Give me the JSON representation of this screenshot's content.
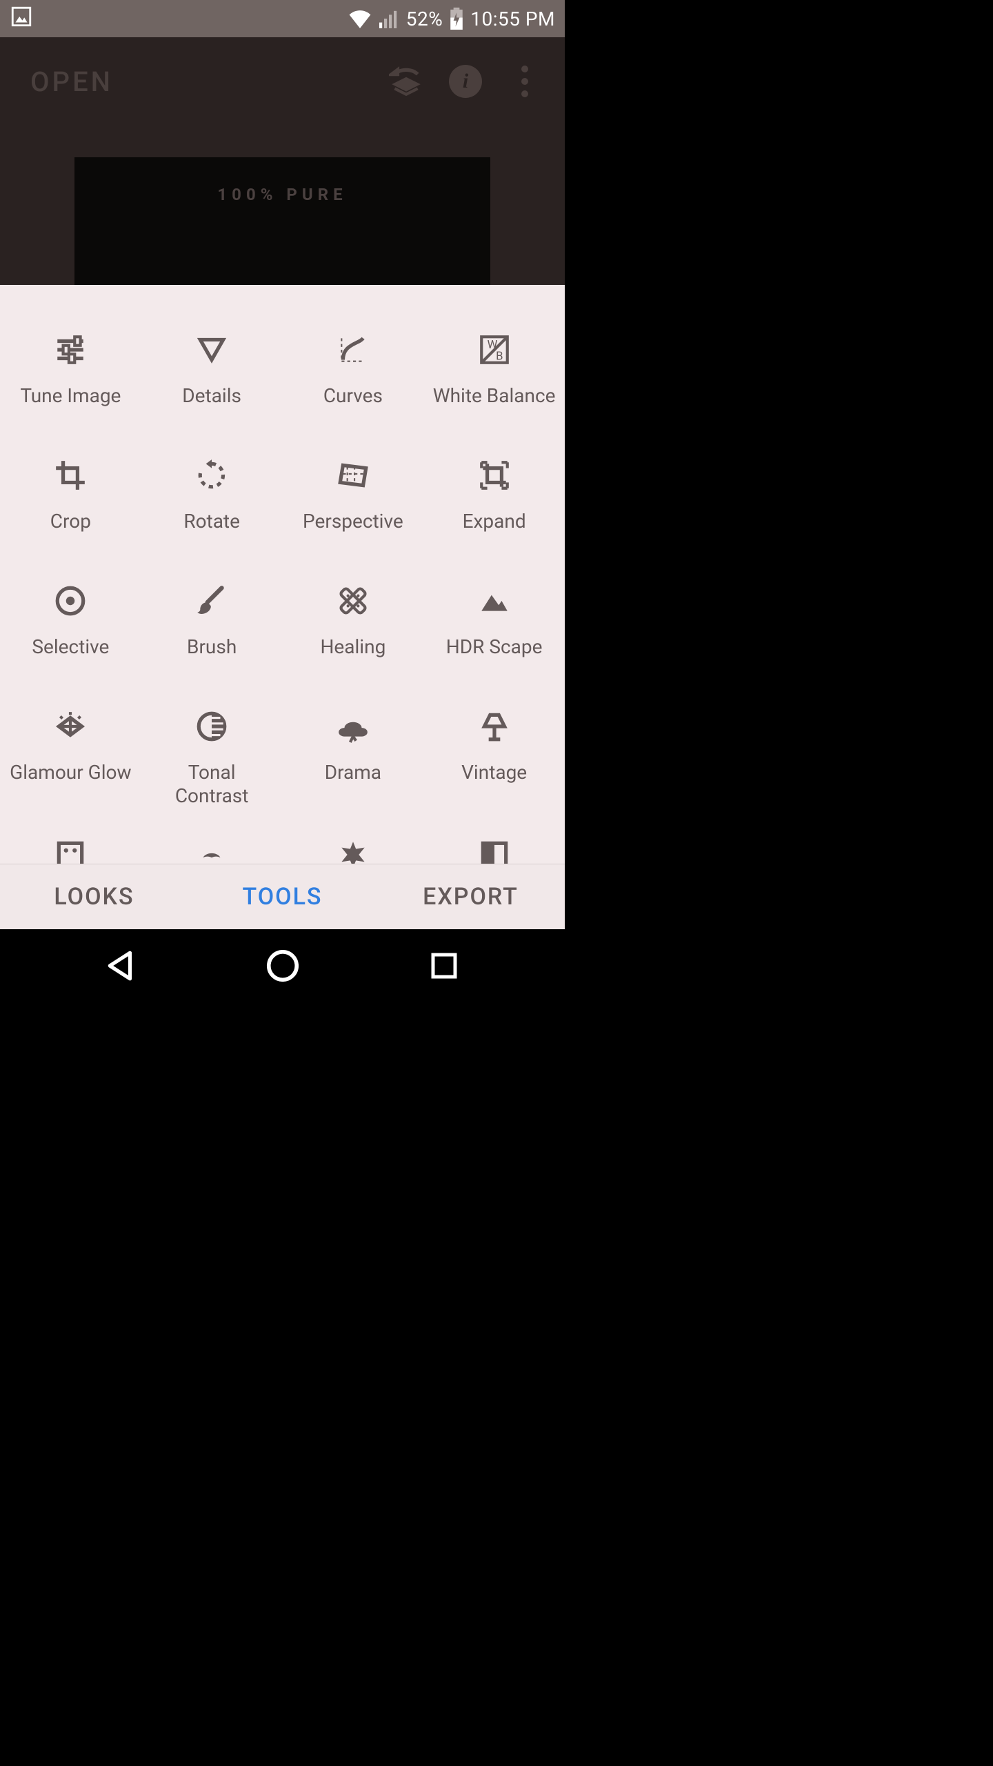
{
  "status": {
    "battery_pct": "52%",
    "time": "10:55 PM"
  },
  "appbar": {
    "open_label": "OPEN"
  },
  "image": {
    "overlay_text": "100% PURE"
  },
  "tools": [
    {
      "name": "tune-image",
      "label": "Tune Image",
      "icon": "tune"
    },
    {
      "name": "details",
      "label": "Details",
      "icon": "details"
    },
    {
      "name": "curves",
      "label": "Curves",
      "icon": "curves"
    },
    {
      "name": "white-balance",
      "label": "White Balance",
      "icon": "wb"
    },
    {
      "name": "crop",
      "label": "Crop",
      "icon": "crop"
    },
    {
      "name": "rotate",
      "label": "Rotate",
      "icon": "rotate"
    },
    {
      "name": "perspective",
      "label": "Perspective",
      "icon": "perspective"
    },
    {
      "name": "expand",
      "label": "Expand",
      "icon": "expand"
    },
    {
      "name": "selective",
      "label": "Selective",
      "icon": "selective"
    },
    {
      "name": "brush",
      "label": "Brush",
      "icon": "brush"
    },
    {
      "name": "healing",
      "label": "Healing",
      "icon": "healing"
    },
    {
      "name": "hdr-scape",
      "label": "HDR Scape",
      "icon": "hdr"
    },
    {
      "name": "glamour-glow",
      "label": "Glamour Glow",
      "icon": "glow"
    },
    {
      "name": "tonal-contrast",
      "label": "Tonal Contrast",
      "icon": "tonal"
    },
    {
      "name": "drama",
      "label": "Drama",
      "icon": "drama"
    },
    {
      "name": "vintage",
      "label": "Vintage",
      "icon": "vintage"
    },
    {
      "name": "grainy-film",
      "label": "",
      "icon": "grainy"
    },
    {
      "name": "retrolux",
      "label": "",
      "icon": "retrolux"
    },
    {
      "name": "grunge",
      "label": "",
      "icon": "grunge"
    },
    {
      "name": "bw",
      "label": "",
      "icon": "bw"
    }
  ],
  "tabs": {
    "looks": "LOOKS",
    "tools": "TOOLS",
    "export": "EXPORT",
    "active": "tools"
  }
}
